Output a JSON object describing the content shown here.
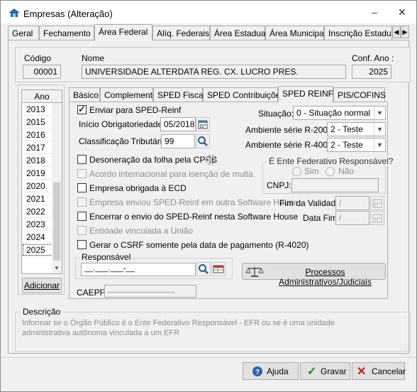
{
  "window": {
    "title": "Empresas (Alteração)",
    "minimize": "–",
    "close": "✕"
  },
  "tabs": [
    "Geral",
    "Fechamento",
    "Área Federal",
    "Alíq. Federais",
    "Área Estadual",
    "Área Municipal",
    "Inscrição Estadual S"
  ],
  "tab_nav": {
    "prev": "◀",
    "next": "▶"
  },
  "header": {
    "codigo_label": "Código",
    "codigo_value": "00001",
    "nome_label": "Nome",
    "nome_value": "UNIVERSIDADE ALTERDATA REG. CX. LUCRO PRES.",
    "conf_ano_label": "Conf. Ano :",
    "conf_ano_value": "2025"
  },
  "years": {
    "header": "Ano",
    "items": [
      "2013",
      "2015",
      "2016",
      "2017",
      "2018",
      "2019",
      "2020",
      "2021",
      "2022",
      "2023",
      "2024",
      "2025"
    ],
    "selected": "2025",
    "scroll_down": "▼",
    "add_button": "Adicionar"
  },
  "subtabs": [
    "Básico",
    "Complemento",
    "SPED Fiscal",
    "SPED Contribuições",
    "SPED REINF",
    "PIS/COFINS"
  ],
  "reinf": {
    "enviar": "Enviar para SPED-Reinf",
    "inicio_label": "Início Obrigatoriedade:",
    "inicio_value": "05/2018",
    "classificacao_label": "Classificação Tributária:",
    "classificacao_value": "99",
    "situacao_label": "Situação:",
    "situacao_value": "0 - Situação normal",
    "amb_r2000_label": "Ambiente série R-2000:",
    "amb_r2000_value": "2 - Teste",
    "amb_r4000_label": "Ambiente série R-4000:",
    "amb_r4000_value": "2 - Teste",
    "desoneracao": "Desoneração da folha pela CPRB",
    "acordo": "Acordo internacional para isenção de multa",
    "obrigada_ecd": "Empresa obrigada à ECD",
    "enviou_outra": "Empresa enviou SPED-Reinf em outra Software House",
    "encerrar": "Encerrar o envio do SPED-Reinf nesta Software House",
    "entidade": "Entidade vinculada a União",
    "gerar_csrf": "Gerar o CSRF somente pela data de pagamento (R-4020)",
    "efr_title": "É Ente Federativo Responsável?",
    "sim": "Sim",
    "nao": "Não",
    "cnpj_label": "CNPJ:",
    "fim_validade_label": "Fim da Validade:",
    "fim_validade_value": "/",
    "data_fim_label": "Data Fim:",
    "data_fim_value": "/",
    "responsavel_label": "Responsável",
    "responsavel_value": "__.___.___-__",
    "processos_button": "Processos Administrativos/Judiciais",
    "caepf_label": "CAEPF:",
    "caepf_value": "_________________"
  },
  "descricao": {
    "label": "Descrição",
    "text": "Informar se o Órgão Público é o Ente Federativo Responsável - EFR ou se é uma unidade administrativa autônoma vinculada a um EFR"
  },
  "buttons": {
    "ajuda": "Ajuda",
    "gravar": "Gravar",
    "cancelar": "Cancelar"
  },
  "colors": {
    "accent": "#3c7fb1",
    "ok": "#1a8a2a",
    "cancel": "#c81e1e",
    "disabled": "#8d8d8d"
  }
}
